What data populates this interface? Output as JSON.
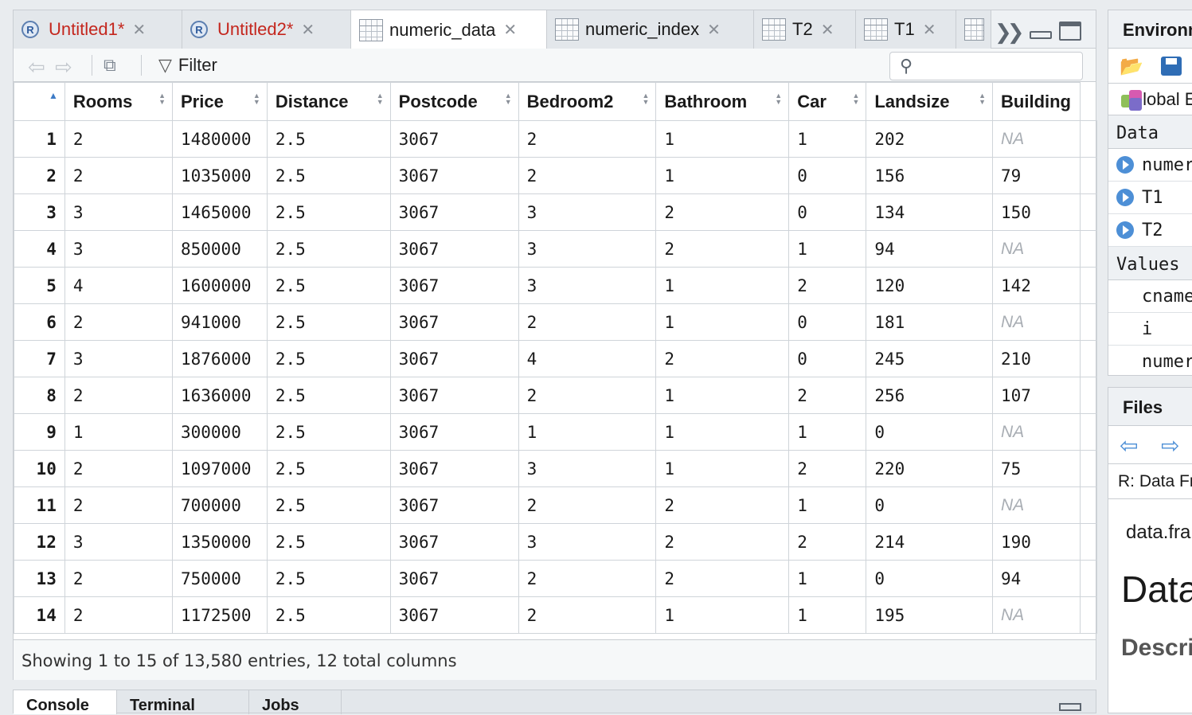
{
  "editor_tabs": [
    {
      "label": "Untitled1*",
      "kind": "script",
      "modified": true
    },
    {
      "label": "Untitled2*",
      "kind": "script",
      "modified": true
    },
    {
      "label": "numeric_data",
      "kind": "data",
      "active": true
    },
    {
      "label": "numeric_index",
      "kind": "data"
    },
    {
      "label": "T2",
      "kind": "data"
    },
    {
      "label": "T1",
      "kind": "data"
    }
  ],
  "toolbar": {
    "filter_label": "Filter",
    "search_placeholder": ""
  },
  "grid": {
    "columns": [
      "Rooms",
      "Price",
      "Distance",
      "Postcode",
      "Bedroom2",
      "Bathroom",
      "Car",
      "Landsize",
      "Building"
    ],
    "rows": [
      {
        "n": "1",
        "cells": [
          "2",
          "1480000",
          "2.5",
          "3067",
          "2",
          "1",
          "1",
          "202",
          "NA"
        ]
      },
      {
        "n": "2",
        "cells": [
          "2",
          "1035000",
          "2.5",
          "3067",
          "2",
          "1",
          "0",
          "156",
          "79"
        ]
      },
      {
        "n": "3",
        "cells": [
          "3",
          "1465000",
          "2.5",
          "3067",
          "3",
          "2",
          "0",
          "134",
          "150"
        ]
      },
      {
        "n": "4",
        "cells": [
          "3",
          "850000",
          "2.5",
          "3067",
          "3",
          "2",
          "1",
          "94",
          "NA"
        ]
      },
      {
        "n": "5",
        "cells": [
          "4",
          "1600000",
          "2.5",
          "3067",
          "3",
          "1",
          "2",
          "120",
          "142"
        ]
      },
      {
        "n": "6",
        "cells": [
          "2",
          "941000",
          "2.5",
          "3067",
          "2",
          "1",
          "0",
          "181",
          "NA"
        ]
      },
      {
        "n": "7",
        "cells": [
          "3",
          "1876000",
          "2.5",
          "3067",
          "4",
          "2",
          "0",
          "245",
          "210"
        ]
      },
      {
        "n": "8",
        "cells": [
          "2",
          "1636000",
          "2.5",
          "3067",
          "2",
          "1",
          "2",
          "256",
          "107"
        ]
      },
      {
        "n": "9",
        "cells": [
          "1",
          "300000",
          "2.5",
          "3067",
          "1",
          "1",
          "1",
          "0",
          "NA"
        ]
      },
      {
        "n": "10",
        "cells": [
          "2",
          "1097000",
          "2.5",
          "3067",
          "3",
          "1",
          "2",
          "220",
          "75"
        ]
      },
      {
        "n": "11",
        "cells": [
          "2",
          "700000",
          "2.5",
          "3067",
          "2",
          "2",
          "1",
          "0",
          "NA"
        ]
      },
      {
        "n": "12",
        "cells": [
          "3",
          "1350000",
          "2.5",
          "3067",
          "3",
          "2",
          "2",
          "214",
          "190"
        ]
      },
      {
        "n": "13",
        "cells": [
          "2",
          "750000",
          "2.5",
          "3067",
          "2",
          "2",
          "1",
          "0",
          "94"
        ]
      },
      {
        "n": "14",
        "cells": [
          "2",
          "1172500",
          "2.5",
          "3067",
          "2",
          "1",
          "1",
          "195",
          "NA"
        ]
      }
    ]
  },
  "status": "Showing 1 to 15 of 13,580 entries, 12 total columns",
  "bottom_tabs": [
    "Console",
    "Terminal",
    "Jobs"
  ],
  "environment": {
    "tab": "Environment",
    "scope": "Global Environment",
    "data_header": "Data",
    "data_items": [
      "numeric_data",
      "T1",
      "T2"
    ],
    "values_header": "Values",
    "value_items": [
      "cnames",
      "i",
      "numeric_index"
    ]
  },
  "files": {
    "tab": "Files",
    "doc_title": "R: Data Frames",
    "doc_line": "data.frame",
    "doc_heading": "Data Frames",
    "doc_section": "Description"
  },
  "colors": {
    "accent": "#3d7bc6",
    "modified": "#c4261d",
    "na": "#a8adb3"
  }
}
